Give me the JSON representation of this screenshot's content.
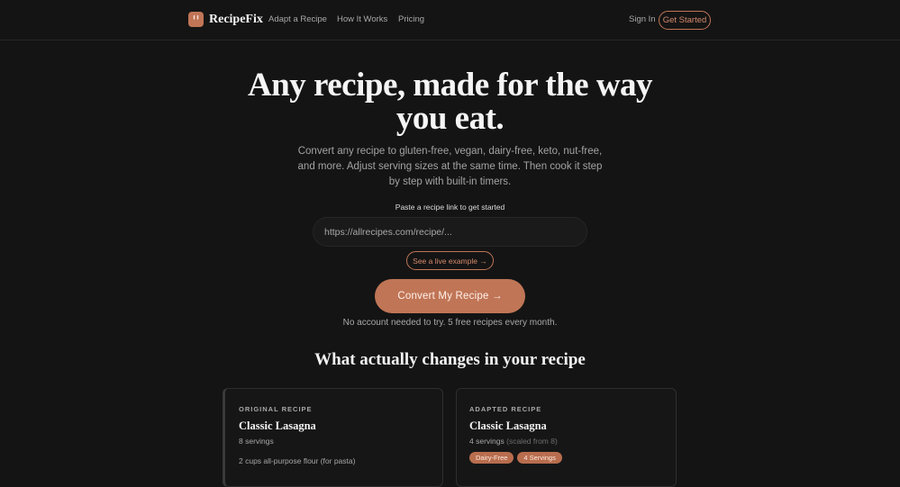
{
  "nav": {
    "brand": "RecipeFix",
    "links": [
      "Adapt a Recipe",
      "How It Works",
      "Pricing"
    ],
    "sign_in": "Sign In",
    "get_started": "Get Started"
  },
  "hero": {
    "title": "Any recipe, made for the way you eat.",
    "subtitle": "Convert any recipe to gluten-free, vegan, dairy-free, keto, nut-free, and more. Adjust serving sizes at the same time. Then cook it step by step with built-in timers.",
    "paste_label": "Paste a recipe link to get started",
    "url_placeholder": "https://allrecipes.com/recipe/...",
    "live_example": "See a live example →",
    "convert_button": "Convert My Recipe →",
    "no_account": "No account needed to try. 5 free recipes every month."
  },
  "changes": {
    "title": "What actually changes in your recipe",
    "original": {
      "kicker": "ORIGINAL RECIPE",
      "title": "Classic Lasagna",
      "servings": "8 servings",
      "ingredient": "2 cups all-purpose flour (for pasta)"
    },
    "adapted": {
      "kicker": "ADAPTED RECIPE",
      "title": "Classic Lasagna",
      "servings": "4 servings",
      "scaled_note": "(scaled from 8)",
      "tags": [
        "Dairy-Free",
        "4 Servings"
      ]
    }
  },
  "colors": {
    "background": "#141414",
    "accent": "#c07556",
    "text": "#f3f3f3",
    "muted": "#a8a8a8"
  },
  "icons": {
    "logo": "fork-knife-icon"
  }
}
